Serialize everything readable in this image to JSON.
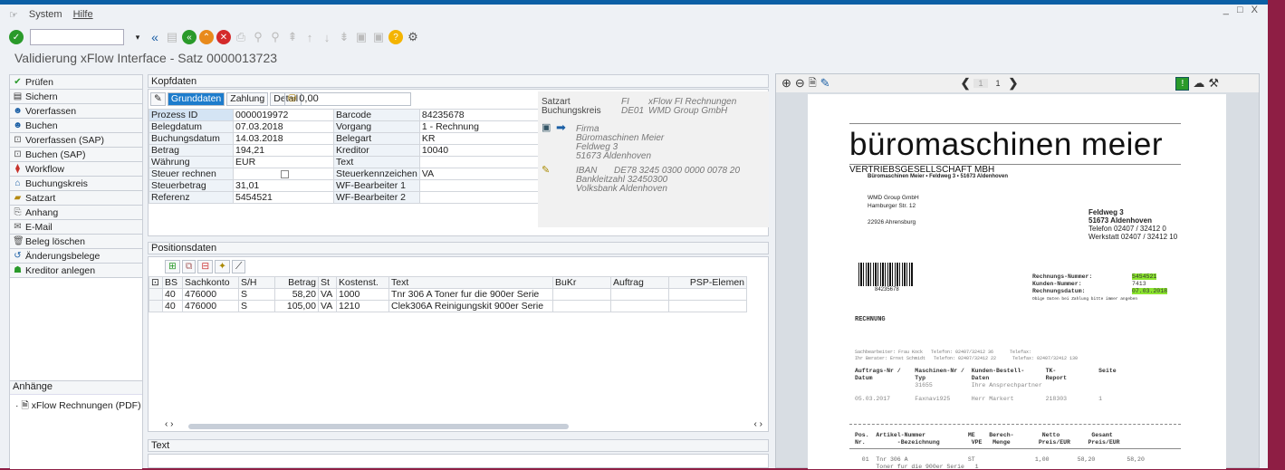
{
  "menu": {
    "system": "System",
    "hilfe": "Hilfe"
  },
  "window_controls": "_ □ X",
  "title": "Validierung xFlow Interface - Satz 0000013723",
  "left_buttons": [
    {
      "label": "Prüfen",
      "icon": "check-icon"
    },
    {
      "label": "Sichern",
      "icon": "save-icon"
    },
    {
      "label": "Vorerfassen",
      "icon": "user-icon"
    },
    {
      "label": "Buchen",
      "icon": "user-icon"
    },
    {
      "label": "Vorerfassen (SAP)",
      "icon": "sap-icon"
    },
    {
      "label": "Buchen (SAP)",
      "icon": "sap-icon"
    },
    {
      "label": "Workflow",
      "icon": "workflow-icon"
    },
    {
      "label": "Buchungskreis",
      "icon": "company-icon"
    },
    {
      "label": "Satzart",
      "icon": "folder-icon"
    },
    {
      "label": "Anhang",
      "icon": "attachment-icon"
    },
    {
      "label": "E-Mail",
      "icon": "mail-icon"
    },
    {
      "label": "Beleg löschen",
      "icon": "trash-icon"
    },
    {
      "label": "Änderungsbelege",
      "icon": "history-icon"
    },
    {
      "label": "Kreditor anlegen",
      "icon": "person-add-icon"
    }
  ],
  "anhaenge": {
    "header": "Anhänge",
    "item": "xFlow Rechnungen (PDF)"
  },
  "kopf": {
    "header": "Kopfdaten",
    "tabs": [
      "Grunddaten",
      "Zahlung",
      "Detail"
    ],
    "betrag_field": "0,00",
    "rows": [
      [
        "Prozess ID",
        "0000019972",
        "Barcode",
        "84235678"
      ],
      [
        "Belegdatum",
        "07.03.2018",
        "Vorgang",
        "1 - Rechnung"
      ],
      [
        "Buchungsdatum",
        "14.03.2018",
        "Belegart",
        "KR"
      ],
      [
        "Betrag",
        "194,21",
        "Kreditor",
        "10040"
      ],
      [
        "Währung",
        "EUR",
        "Text",
        ""
      ],
      [
        "Steuer rechnen",
        "",
        "Steuerkennzeichen",
        "VA"
      ],
      [
        "Steuerbetrag",
        "31,01",
        "WF-Bearbeiter 1",
        ""
      ],
      [
        "Referenz",
        "5454521",
        "WF-Bearbeiter 2",
        ""
      ]
    ],
    "info": {
      "satzart_l": "Satzart",
      "satzart_c": "FI",
      "satzart_t": "xFlow FI Rechnungen",
      "bk_l": "Buchungskreis",
      "bk_c": "DE01",
      "bk_t": "WMD Group GmbH",
      "firma": "Firma",
      "name": "Büromaschinen Meier",
      "street": "Feldweg 3",
      "city": "51673 Aldenhoven",
      "iban_l": "IBAN",
      "iban": "DE78 3245 0300 0000 0078 20",
      "blz": "Bankleitzahl 32450300",
      "bank": "Volksbank Aldenhoven"
    }
  },
  "pos": {
    "header": "Positionsdaten",
    "cols": [
      "BS",
      "Sachkonto",
      "S/H",
      "Betrag",
      "St",
      "Kostenst.",
      "Text",
      "BuKr",
      "Auftrag",
      "PSP-Elemen"
    ],
    "rows": [
      [
        "40",
        "476000",
        "S",
        "58,20",
        "VA",
        "1000",
        "Tnr 306 A Toner fur die 900er Serie",
        "",
        "",
        ""
      ],
      [
        "40",
        "476000",
        "S",
        "105,00",
        "VA",
        "1210",
        "Clek306A Reinigungskit 900er Serie",
        "",
        "",
        ""
      ]
    ]
  },
  "text_header": "Text",
  "viewer": {
    "page_current": "1",
    "page_total": "1"
  },
  "doc": {
    "company": "büromaschinen meier",
    "sub": "VERTRIEBSGESELLSCHAFT MBH",
    "sender": "Büromaschinen Meier • Feldweg 3 • 51673 Aldenhoven",
    "addr1": "WMD Group GmbH",
    "addr2": "Hamburger Str. 12",
    "addr3": "22926 Ahrensburg",
    "r1": "Feldweg 3",
    "r2": "51673 Aldenhoven",
    "r3": "Telefon 02407 / 32412 0",
    "r4": "Werkstatt 02407 / 32412 10",
    "barcode_no": "84235678",
    "rn_l": "Rechnungs-Nummer:",
    "rn": "5454521",
    "kn_l": "Kunden-Nummer:",
    "kn": "7413",
    "rd_l": "Rechnungsdatum:",
    "rd": "07.03.2018",
    "note": "Obige Daten bei Zahlung bitte immer angeben",
    "rechnung": "RECHNUNG",
    "s1": "Sachbearbeiter: Frau Kock   Telefon: 02407/32412 36      Telefax:",
    "s2": "Ihr Berater: Ernst Schmidt   Telefon: 02407/32412 22      Telefax: 02407/32412 130",
    "h1": "Auftrags-Nr /    Maschinen-Nr /  Kunden-Bestell-      TK-            Seite",
    "h2": "Datum            Typ             Daten                Report",
    "h3": "                 31655           Ihre Ansprechpartner",
    "d1": "05.03.2017       Faxnavi925      Herr Markert         218303         1",
    "ph1": "Pos.  Artikel-Nummer            ME    Berech-        Netto         Gesamt",
    "ph2": "Nr.         -Bezeichnung         VPE   Menge        Preis/EUR     Preis/EUR",
    "p1": "  01  Tnr 306 A                 ST                 1,00        58,20         58,20",
    "p2": "      Toner fur die 900er Serie   1"
  }
}
